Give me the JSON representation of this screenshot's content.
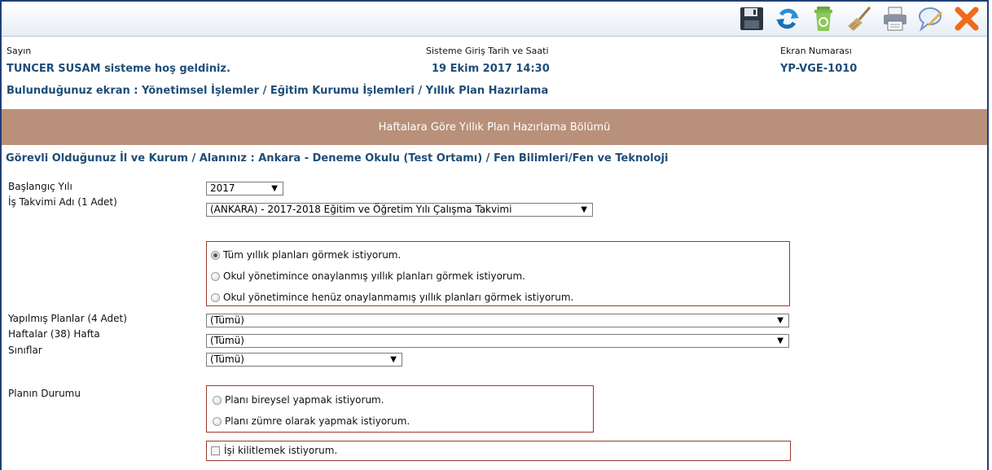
{
  "toolbar": {
    "icons": [
      "save-icon",
      "refresh-icon",
      "recycle-bin-icon",
      "broom-icon",
      "print-icon",
      "comment-icon",
      "close-icon"
    ]
  },
  "header": {
    "greeting_label": "Sayın",
    "user_text": "TUNCER SUSAM sisteme hoş geldiniz.",
    "login_label": "Sisteme Giriş Tarih ve Saati",
    "login_value": "19 Ekim 2017 14:30",
    "screen_label": "Ekran Numarası",
    "screen_value": "YP-VGE-1010",
    "breadcrumb": "Bulunduğunuz ekran : Yönetimsel İşlemler / Eğitim Kurumu İşlemleri / Yıllık Plan Hazırlama"
  },
  "banner": "Haftalara Göre Yıllık Plan Hazırlama Bölümü",
  "institution": "Görevli Olduğunuz İl ve Kurum / Alanınız : Ankara - Deneme Okulu (Test Ortamı) / Fen Bilimleri/Fen ve Teknoloji",
  "form": {
    "start_year_label": "Başlangıç Yılı",
    "start_year_value": "2017",
    "calendar_label": "İş Takvimi Adı (1 Adet)",
    "calendar_value": "(ANKARA) - 2017-2018 Eğitim ve Öğretim Yılı Çalışma Takvimi",
    "view_options": [
      "Tüm yıllık planları görmek istiyorum.",
      "Okul yönetimince onaylanmış yıllık planları görmek istiyorum.",
      "Okul yönetimince henüz onaylanmamış yıllık planları görmek istiyorum."
    ],
    "plans_label": "Yapılmış Planlar (4 Adet)",
    "plans_value": "(Tümü)",
    "weeks_label": "Haftalar (38) Hafta",
    "weeks_value": "(Tümü)",
    "classes_label": "Sınıflar",
    "classes_value": "(Tümü)",
    "status_label": "Planın Durumu",
    "status_options": [
      "Planı bireysel yapmak istiyorum.",
      "Planı zümre olarak yapmak istiyorum."
    ],
    "lock_label": "İşi kilitlemek istiyorum."
  }
}
